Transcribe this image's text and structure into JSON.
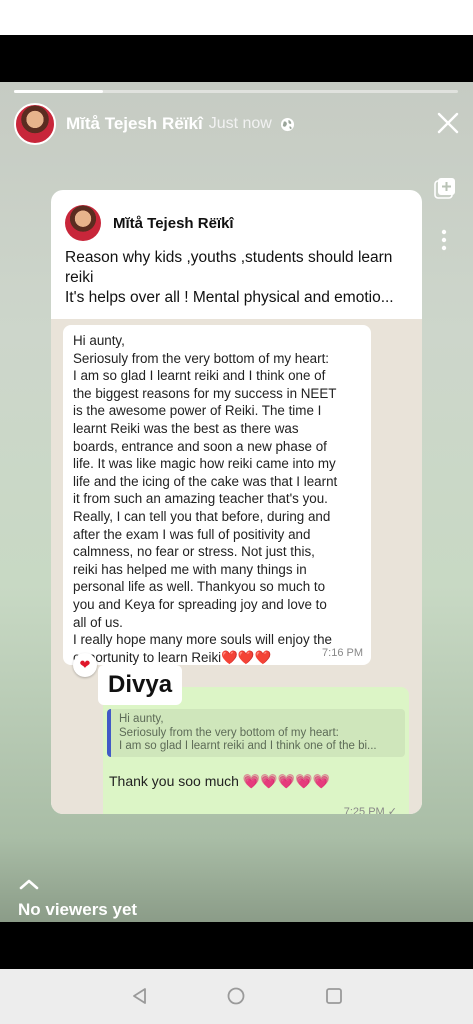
{
  "story": {
    "user_name": "Mĭtå Tejesh Rëïkî",
    "time_label": "Just now",
    "progress": 0.2,
    "icons": {
      "globe": "globe-icon",
      "close": "close-icon",
      "add": "add-to-story-icon",
      "more": "more-vertical-icon"
    }
  },
  "post": {
    "author": "Mĭtå Tejesh Rëïkî",
    "line1": "Reason why kids ,youths ,students should learn reiki",
    "line2": "It's helps over all ! Mental physical and emotio..."
  },
  "chat": {
    "incoming": {
      "lines": [
        "Hi aunty,",
        "Seriosuly from the very bottom of my heart:",
        "I am so glad I learnt reiki and I think one of",
        "the biggest reasons for my success in NEET",
        "is the awesome power of Reiki. The time I",
        "learnt Reiki was the best as there was",
        "boards, entrance and soon a new phase of",
        "life. It was like magic how reiki came into my",
        "life and the icing of the cake was that I learnt",
        "it from such an amazing teacher that's you.",
        "Really, I can tell you that before, during and",
        "after the exam I was full of positivity and",
        "calmness, no fear or stress. Not just this,",
        "reiki has helped me with many things in",
        "personal life as well. Thankyou so much to",
        "you and Keya for spreading joy and love to",
        "all of us.",
        "I really hope many more souls will enjoy the",
        "opportunity to learn Reiki❤️❤️❤️"
      ],
      "time": "7:16 PM",
      "reaction": "❤"
    },
    "sender_label": "Divya",
    "outgoing": {
      "quote_lines": [
        "Hi aunty,",
        "Seriosuly from the very bottom of my heart:",
        "I am so glad I learnt reiki and I think one of the bi..."
      ],
      "text": "Thank you soo much 💗💗💗💗💗",
      "time": "7:25 PM ✓"
    }
  },
  "footer": {
    "viewers_text": "No viewers yet"
  },
  "nav": {
    "back": "back-icon",
    "home": "home-icon",
    "recent": "recent-apps-icon"
  }
}
